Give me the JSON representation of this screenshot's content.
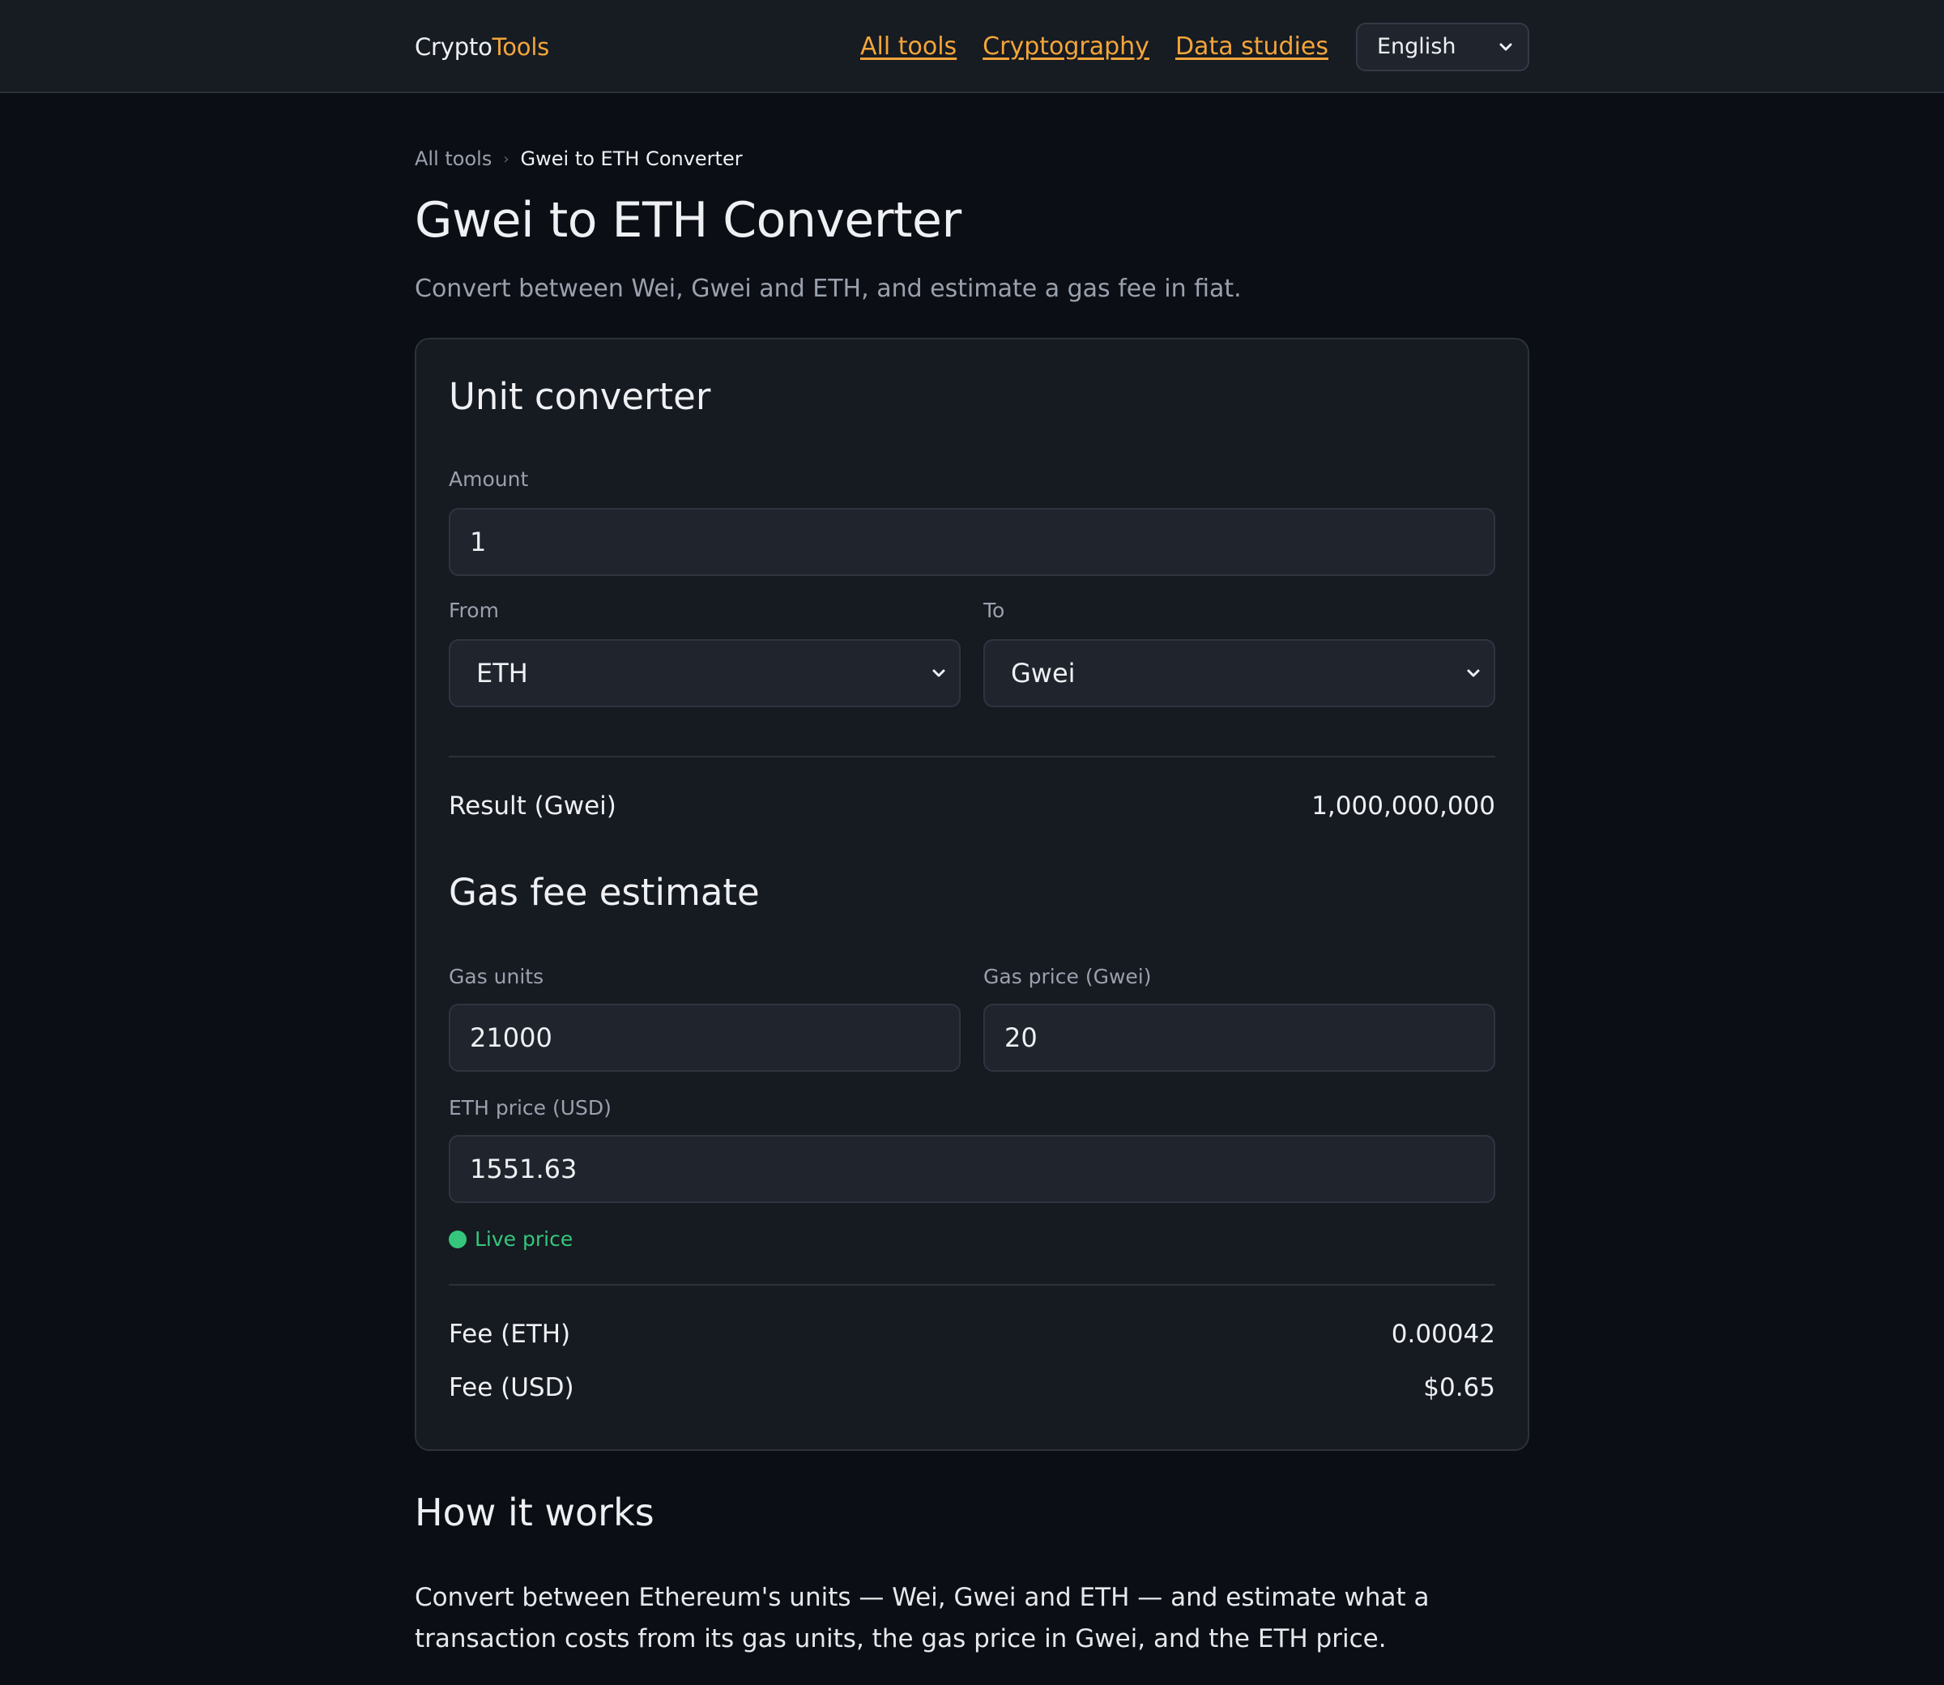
{
  "header": {
    "logo_part1": "Crypto",
    "logo_part2": "Tools",
    "nav": [
      "All tools",
      "Cryptography",
      "Data studies"
    ],
    "language": "English"
  },
  "breadcrumb": {
    "root": "All tools",
    "current": "Gwei to ETH Converter"
  },
  "page": {
    "title": "Gwei to ETH Converter",
    "subtitle": "Convert between Wei, Gwei and ETH, and estimate a gas fee in fiat."
  },
  "converter": {
    "heading": "Unit converter",
    "amount_label": "Amount",
    "amount_value": "1",
    "from_label": "From",
    "from_value": "ETH",
    "to_label": "To",
    "to_value": "Gwei",
    "result_label": "Result (Gwei)",
    "result_value": "1,000,000,000"
  },
  "gas": {
    "heading": "Gas fee estimate",
    "units_label": "Gas units",
    "units_value": "21000",
    "price_label": "Gas price (Gwei)",
    "price_value": "20",
    "eth_price_label": "ETH price (USD)",
    "eth_price_value": "1551.63",
    "live_label": "Live price",
    "fee_eth_label": "Fee (ETH)",
    "fee_eth_value": "0.00042",
    "fee_usd_label": "Fee (USD)",
    "fee_usd_value": "$0.65"
  },
  "how": {
    "heading": "How it works",
    "text": "Convert between Ethereum's units — Wei, Gwei and ETH — and estimate what a transaction costs from its gas units, the gas price in Gwei, and the ETH price."
  },
  "colors": {
    "accent": "#f2a53a",
    "live": "#34c77b",
    "background": "#0b0e14",
    "card": "#161a21"
  },
  "icons": {
    "select": "chevron-down-icon",
    "live": "status-dot-icon",
    "breadcrumb_sep": "chevron-right-icon"
  }
}
